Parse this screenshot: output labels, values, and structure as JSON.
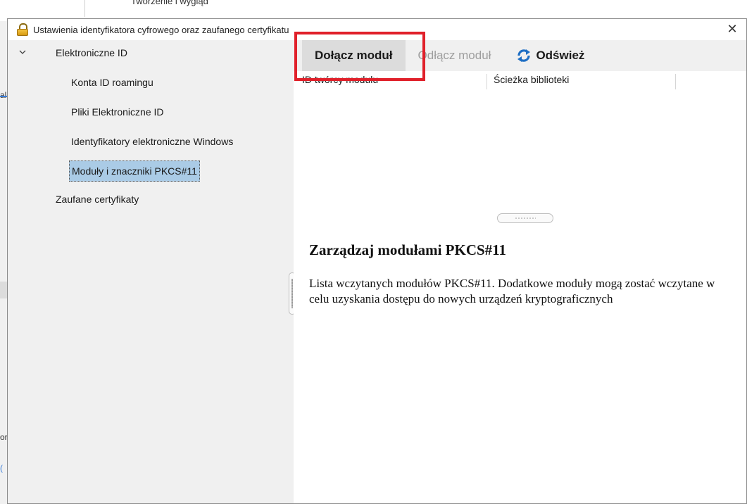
{
  "background_app": {
    "tab_fragment": "Tworzenie i wygląd",
    "left_fragments": [
      "al",
      "or",
      "("
    ]
  },
  "dialog": {
    "title": "Ustawienia identyfikatora cyfrowego oraz zaufanego certyfikatu",
    "close_glyph": "✕"
  },
  "tree": {
    "items": [
      {
        "label": "Elektroniczne ID",
        "level": 0,
        "expanded": true
      },
      {
        "label": "Konta ID roamingu",
        "level": 1
      },
      {
        "label": "Pliki Elektroniczne ID",
        "level": 1
      },
      {
        "label": "Identyfikatory elektroniczne Windows",
        "level": 1
      },
      {
        "label": "Moduły i znaczniki PKCS#11",
        "level": 1,
        "selected": true
      },
      {
        "label": "Zaufane certyfikaty",
        "level": 0
      }
    ]
  },
  "toolbar": {
    "attach_label": "Dołącz moduł",
    "detach_label": "Odłącz moduł",
    "refresh_label": "Odśwież"
  },
  "table": {
    "columns": [
      "ID twórcy modułu",
      "Ścieżka biblioteki"
    ]
  },
  "info": {
    "heading": "Zarządzaj modułami PKCS#11",
    "description": "Lista wczytanych modułów PKCS#11. Dodatkowe moduły mogą zostać wczytane w celu uzyskania dostępu do nowych urządzeń kryptograficznych"
  },
  "colors": {
    "selection": "#aacbe6",
    "highlight_box": "#e0202a",
    "refresh_icon": "#1f6fc4"
  }
}
